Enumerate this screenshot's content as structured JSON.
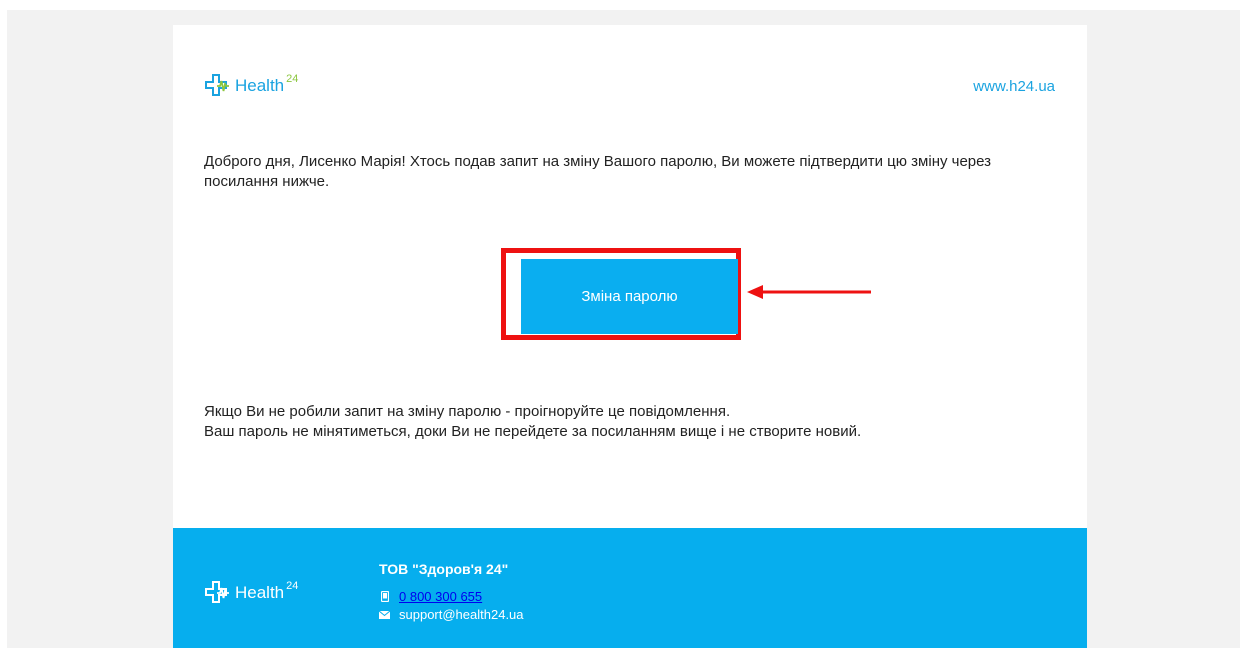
{
  "header": {
    "brand": "Health",
    "brand_superscript": "24",
    "site_link": "www.h24.ua"
  },
  "body": {
    "greeting": "Доброго дня, Лисенко Марія! Хтось подав запит на зміну Вашого паролю, Ви можете підтвердити цю зміну через посилання нижче.",
    "button_label": "Зміна паролю",
    "notice_line1": "Якщо Ви не робили запит на зміну паролю - проігноруйте це повідомлення.",
    "notice_line2": "Ваш пароль не мінятиметься, доки Ви не перейдете за посиланням вище і не створите новий."
  },
  "footer": {
    "brand": "Health",
    "brand_superscript": "24",
    "company": "ТОВ \"Здоров'я 24\"",
    "phone": "0 800 300 655",
    "email": "support@health24.ua"
  },
  "colors": {
    "brand_blue": "#1aa3e0",
    "brand_green": "#8cc63f",
    "button_blue": "#0aaef0",
    "footer_blue": "#06aeee",
    "highlight_red": "#ee1111"
  },
  "icons": {
    "logo": "medical-cross-pulse-icon",
    "phone": "phone-icon",
    "email": "envelope-icon",
    "annotation": "arrow-left-icon"
  }
}
